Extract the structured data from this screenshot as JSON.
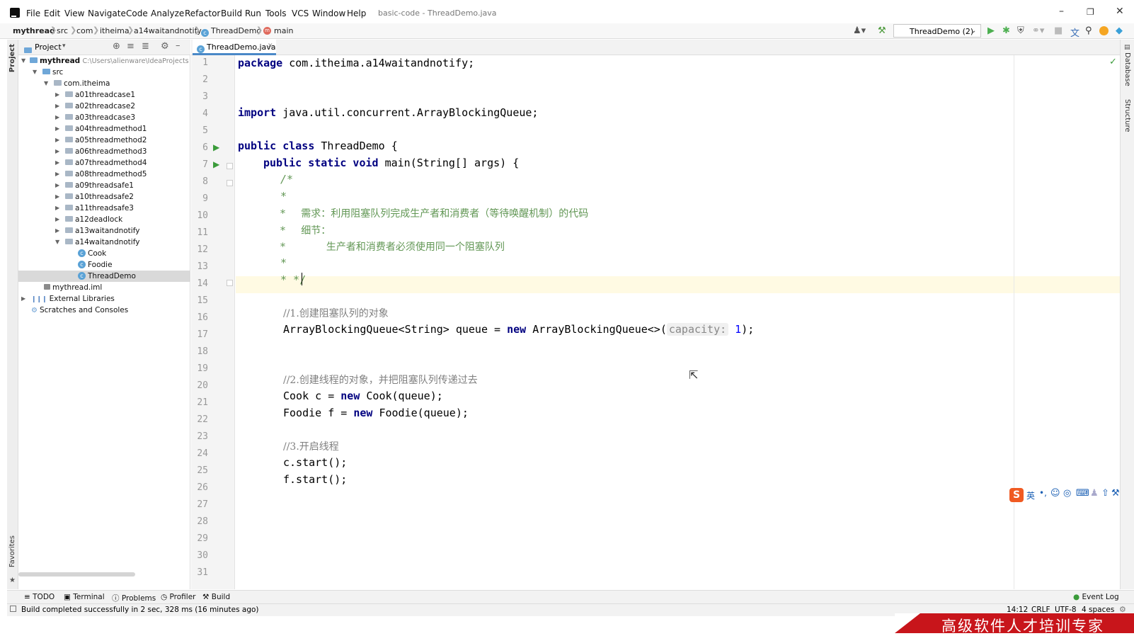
{
  "menu": [
    "File",
    "Edit",
    "View",
    "Navigate",
    "Code",
    "Analyze",
    "Refactor",
    "Build",
    "Run",
    "Tools",
    "VCS",
    "Window",
    "Help"
  ],
  "window_title": "basic-code - ThreadDemo.java",
  "breadcrumbs": [
    "mythread",
    "src",
    "com",
    "itheima",
    "a14waitandnotify",
    "ThreadDemo",
    "main"
  ],
  "run_config": "ThreadDemo (2)",
  "project_panel": {
    "title": "Project",
    "root": "mythread",
    "root_path": "C:\\Users\\alienware\\IdeaProjects",
    "src": "src",
    "package": "com.itheima",
    "folders": [
      "a01threadcase1",
      "a02threadcase2",
      "a03threadcase3",
      "a04threadmethod1",
      "a05threadmethod2",
      "a06threadmethod3",
      "a07threadmethod4",
      "a08threadmethod5",
      "a09threadsafe1",
      "a10threadsafe2",
      "a11threadsafe3",
      "a12deadlock",
      "a13waitandnotify",
      "a14waitandnotify"
    ],
    "classes": [
      "Cook",
      "Foodie",
      "ThreadDemo"
    ],
    "iml": "mythread.iml",
    "external": "External Libraries",
    "scratches": "Scratches and Consoles"
  },
  "editor": {
    "tab": "ThreadDemo.java",
    "line_numbers": [
      "1",
      "2",
      "3",
      "4",
      "5",
      "6",
      "7",
      "8",
      "9",
      "10",
      "11",
      "12",
      "13",
      "14",
      "15",
      "16",
      "17",
      "18",
      "19",
      "20",
      "21",
      "22",
      "23",
      "24",
      "25",
      "26",
      "27",
      "28",
      "29",
      "30",
      "31"
    ],
    "lines": {
      "l1_kw": "package",
      "l1": " com.itheima.a14waitandnotify;",
      "l4_kw": "import",
      "l4": " java.util.concurrent.ArrayBlockingQueue;",
      "l6_kw": "public class",
      "l6": " ThreadDemo {",
      "l7_kw": "public static void",
      "l7": " main(String[] args) {",
      "l8": "/*",
      "l9": "*",
      "l10": "*     需求：利用阻塞队列完成生产者和消费者（等待唤醒机制）的代码",
      "l11": "*     细节：",
      "l12": "*             生产者和消费者必须使用同一个阻塞队列",
      "l13": "*",
      "l14": "* */",
      "l16": "//1.创建阻塞队列的对象",
      "l17a": "ArrayBlockingQueue<String> queue = ",
      "l17_kw": "new",
      "l17b": " ArrayBlockingQueue<>(",
      "l17_hint": "capacity:",
      "l17_num": "1",
      "l17c": ");",
      "l20": "//2.创建线程的对象，并把阻塞队列传递过去",
      "l21a": "Cook c = ",
      "l21_kw": "new",
      "l21b": " Cook(queue);",
      "l22a": "Foodie f = ",
      "l22_kw": "new",
      "l22b": " Foodie(queue);",
      "l24": "//3.开启线程",
      "l25": "c.start();",
      "l26": "f.start();"
    }
  },
  "left_stripe": {
    "project": "Project",
    "favorites": "Favorites"
  },
  "right_stripe": {
    "database": "Database",
    "structure": "Structure"
  },
  "bottom_tools": [
    "TODO",
    "Terminal",
    "Problems",
    "Profiler",
    "Build"
  ],
  "event_log": "Event Log",
  "status": {
    "message": "Build completed successfully in 2 sec, 328 ms (16 minutes ago)",
    "position": "14:12",
    "line_sep": "CRLF",
    "encoding": "UTF-8",
    "indent": "4 spaces"
  },
  "ime": {
    "mode": "英"
  },
  "banner": "高级软件人才培训专家"
}
